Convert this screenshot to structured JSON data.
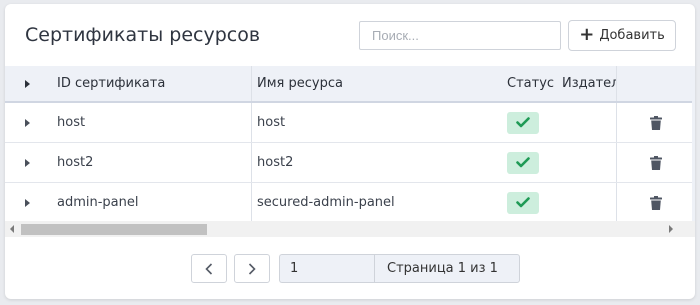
{
  "header": {
    "title": "Сертификаты ресурсов",
    "search_placeholder": "Поиск...",
    "add_label": "Добавить"
  },
  "table": {
    "columns": [
      "ID сертификата",
      "Имя ресурса",
      "Статус",
      "Издател"
    ],
    "rows": [
      {
        "id": "host",
        "name": "host",
        "status": "ok"
      },
      {
        "id": "host2",
        "name": "host2",
        "status": "ok"
      },
      {
        "id": "admin-panel",
        "name": "secured-admin-panel",
        "status": "ok"
      }
    ]
  },
  "pagination": {
    "page_value": "1",
    "page_label": "Страница 1 из 1"
  },
  "colors": {
    "status_ok_bg": "#cdeedd",
    "status_ok_check": "#1f9a55",
    "trash_icon": "#4f5663"
  }
}
